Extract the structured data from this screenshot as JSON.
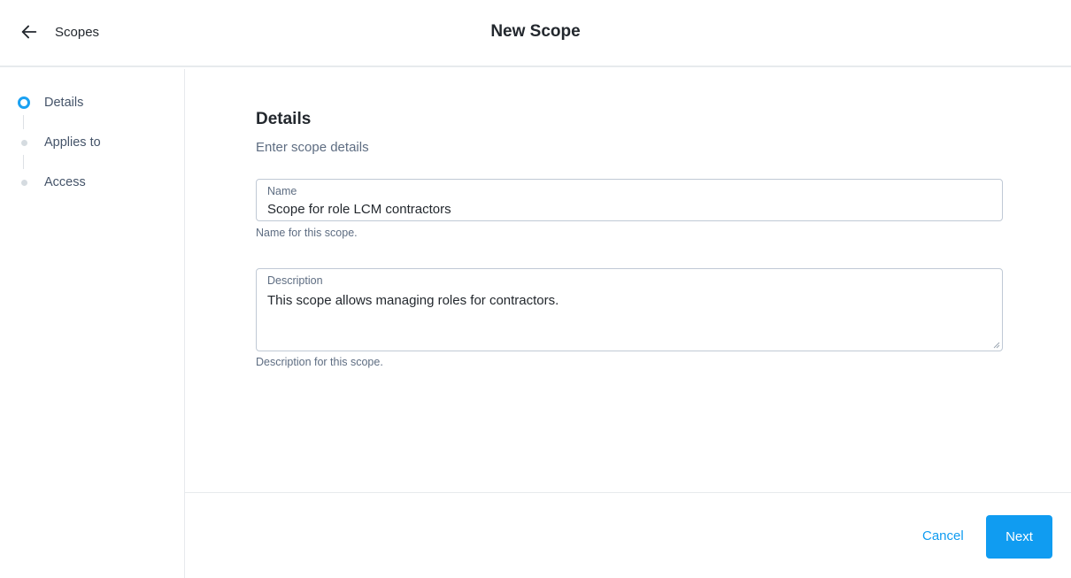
{
  "header": {
    "back_label": "Scopes",
    "title": "New Scope",
    "back_icon": "arrow-left-icon"
  },
  "steps": [
    {
      "label": "Details",
      "state": "active"
    },
    {
      "label": "Applies to",
      "state": "pending"
    },
    {
      "label": "Access",
      "state": "pending"
    }
  ],
  "main": {
    "title": "Details",
    "subtitle": "Enter scope details",
    "name_field": {
      "label": "Name",
      "value": "Scope for role LCM contractors",
      "help": "Name for this scope."
    },
    "description_field": {
      "label": "Description",
      "value": "This scope allows managing roles for contractors.",
      "help": "Description for this scope."
    }
  },
  "footer": {
    "cancel_label": "Cancel",
    "next_label": "Next"
  },
  "colors": {
    "accent": "#109cf1",
    "text": "#23282e",
    "muted": "#5e6d82",
    "border": "#c0c9d5"
  }
}
